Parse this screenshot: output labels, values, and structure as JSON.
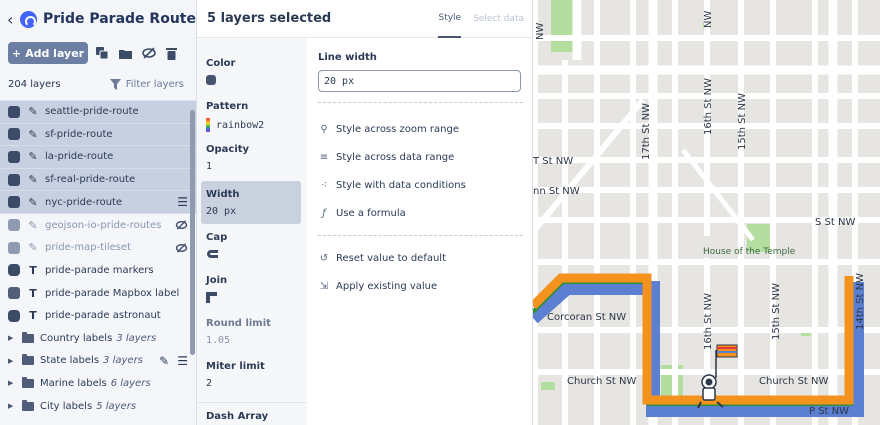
{
  "app": {
    "title": "Pride Parade Route"
  },
  "toolbar": {
    "add_layer": "Add layer"
  },
  "layer_count": "204 layers",
  "filter_label": "Filter layers",
  "layers": [
    {
      "name": "seattle-pride-route",
      "type": "line",
      "selected": true
    },
    {
      "name": "sf-pride-route",
      "type": "line",
      "selected": true
    },
    {
      "name": "la-pride-route",
      "type": "line",
      "selected": true
    },
    {
      "name": "sf-real-pride-route",
      "type": "line",
      "selected": true
    },
    {
      "name": "nyc-pride-route",
      "type": "line",
      "selected": true
    },
    {
      "name": "geojson-io-pride-routes",
      "type": "line",
      "hidden": true
    },
    {
      "name": "pride-map-tileset",
      "type": "line",
      "hidden": true
    },
    {
      "name": "pride-parade markers",
      "type": "symbol"
    },
    {
      "name": "pride-parade Mapbox label",
      "type": "symbol"
    },
    {
      "name": "pride-parade astronaut",
      "type": "symbol"
    }
  ],
  "groups": [
    {
      "name": "Country labels",
      "count": "3 layers"
    },
    {
      "name": "State labels",
      "count": "3 layers"
    },
    {
      "name": "Marine labels",
      "count": "6 layers"
    },
    {
      "name": "City labels",
      "count": "5 layers"
    }
  ],
  "editor": {
    "title": "5 layers selected",
    "tab_style": "Style",
    "tab_select": "Select data"
  },
  "properties": [
    {
      "label": "Color",
      "value": ""
    },
    {
      "label": "Pattern",
      "value": "rainbow2"
    },
    {
      "label": "Opacity",
      "value": "1"
    },
    {
      "label": "Width",
      "value": "20 px"
    },
    {
      "label": "Cap",
      "value": ""
    },
    {
      "label": "Join",
      "value": ""
    },
    {
      "label": "Round limit",
      "value": "1.05"
    },
    {
      "label": "Miter limit",
      "value": "2"
    },
    {
      "label": "Dash Array",
      "value": ""
    }
  ],
  "detail": {
    "label": "Line width",
    "value": "20  px",
    "options": [
      "Style across zoom range",
      "Style across data range",
      "Style with data conditions",
      "Use a formula"
    ],
    "actions": [
      "Reset value to default",
      "Apply existing value"
    ]
  },
  "map": {
    "labels": [
      "Corcoran St NW",
      "Church St NW",
      "Church St NW",
      "P St NW",
      "17th St NW",
      "16th St NW",
      "15th St NW",
      "16th St NW",
      "15th St NW",
      "14th St NW",
      "S St NW",
      "T St NW",
      "nn St NW",
      "House of the Temple",
      "NW",
      "NW"
    ],
    "colors": {
      "route_orange": "#f4921e",
      "route_blue": "#5b7fd1",
      "route_green": "#2f8f3a",
      "park": "#b4dea0",
      "road": "#ffffff",
      "land": "#e7e5e2"
    }
  }
}
